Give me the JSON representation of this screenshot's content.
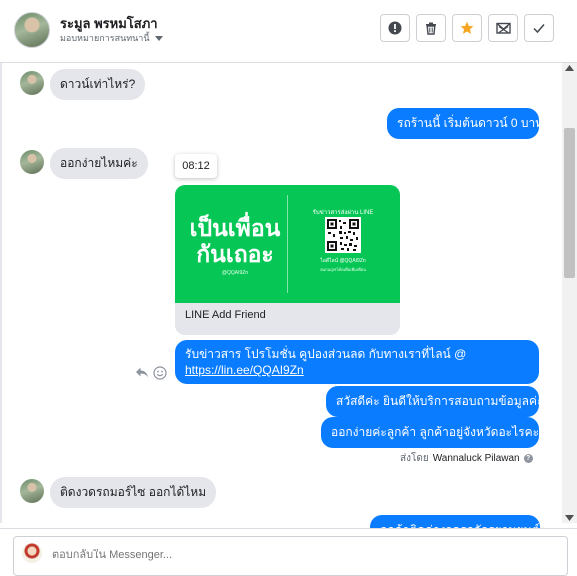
{
  "header": {
    "contact_name": "ระมูล พรหมโสภา",
    "assign_label": "มอบหมายการสนทนานี้",
    "actions": [
      {
        "name": "mark-spam-button",
        "icon": "exclamation-circle-icon"
      },
      {
        "name": "delete-button",
        "icon": "trash-icon"
      },
      {
        "name": "star-button",
        "icon": "star-icon",
        "color": "#f5a623"
      },
      {
        "name": "mark-unread-button",
        "icon": "envelope-x-icon"
      },
      {
        "name": "mark-done-button",
        "icon": "check-icon"
      }
    ]
  },
  "messages": {
    "m1": "ดาวน์เท่าไหร่?",
    "m2": "รถร้านนี้ เริ่มต้นดาวน์ 0 บาท",
    "m3": "ออกง่ายไหมค่ะ",
    "tooltip_time": "08:12",
    "card": {
      "headline_line1": "เป็นเพื่อน",
      "headline_line2": "กันเถอะ",
      "headline_sub": "@QQAI9Zn",
      "qr_title": "รับข่าวสารส่งผ่าน LINE",
      "qr_id": "ไอดีไลน์ @QQAI9Zn",
      "qr_desc": "สแกนQRโค้ดเพื่อเพิ่มเพื่อน",
      "caption": "LINE Add Friend"
    },
    "m4_text": "รับข่าวสาร  โปรโมชั่น คูปองส่วนลด กับทางเราที่ไลน์ @",
    "m4_link": "https://lin.ee/QQAI9Zn",
    "m5": "สวัสดีค่ะ  ยินดีให้บริการสอบถามข้อมูลค่ะ",
    "m6": "ออกง่ายค่ะลูกค้า  ลูกค้าอยู่จังหวัดอะไรคะ",
    "sent_by_prefix": "ส่งโดย",
    "sent_by_name": "Wannaluck Pilawan",
    "m7": "ติดงวดรถมอร์ไซ ออกได้ไหม",
    "m8_partial": "ลูกค้าติดค่างวดรถจักรยานยนต์"
  },
  "colors": {
    "outgoing_bubble": "#0a7cff",
    "incoming_bubble": "#e4e6eb",
    "line_green": "#06c755",
    "star": "#f5a623"
  },
  "composer": {
    "placeholder": "ตอบกลับใน Messenger..."
  }
}
